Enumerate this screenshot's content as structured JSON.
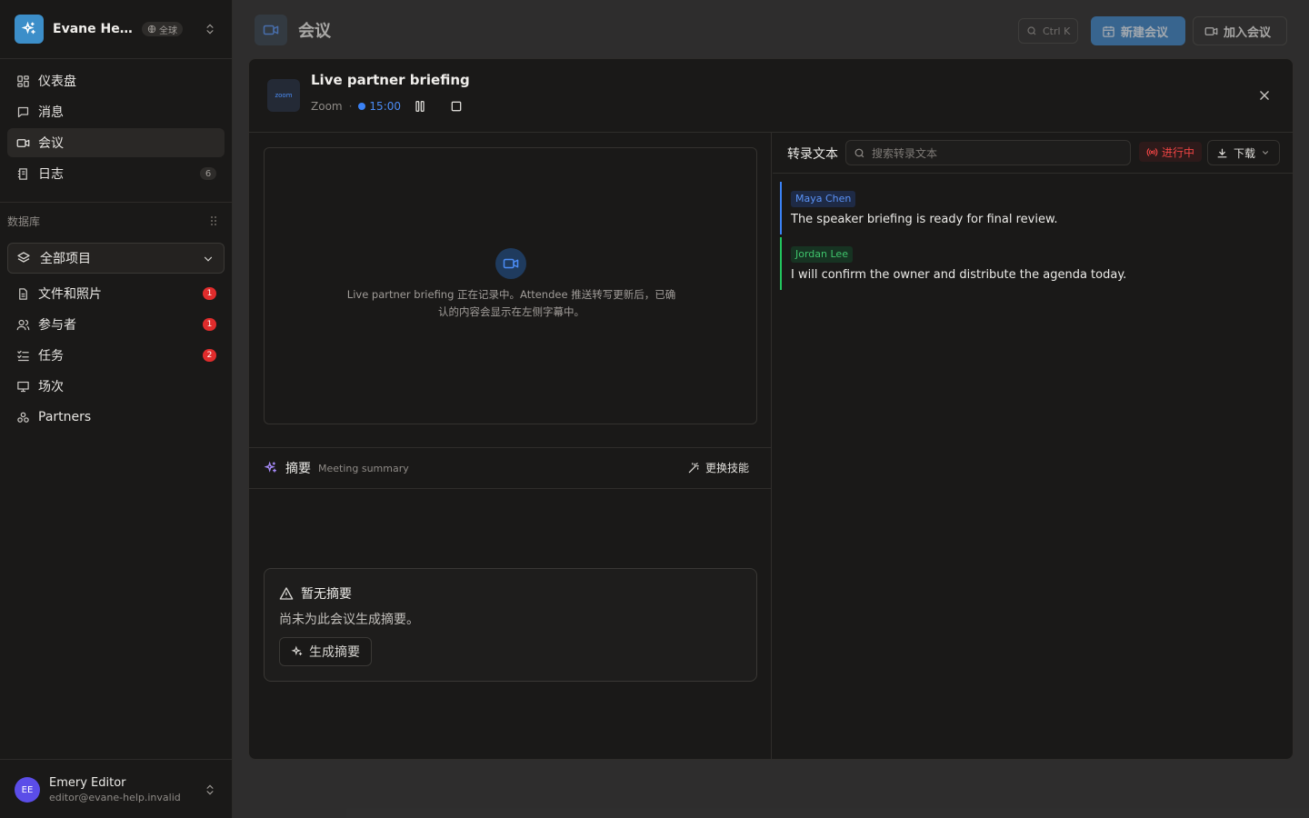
{
  "workspace": {
    "name": "Evane Help Center",
    "badge": "全球"
  },
  "nav": [
    {
      "id": "dashboard",
      "label": "仪表盘",
      "icon": "dashboard-icon"
    },
    {
      "id": "messages",
      "label": "消息",
      "icon": "message-icon"
    },
    {
      "id": "meetings",
      "label": "会议",
      "icon": "video-icon",
      "active": true
    },
    {
      "id": "logs",
      "label": "日志",
      "icon": "log-icon",
      "count": "6"
    }
  ],
  "database": {
    "label": "数据库",
    "project_select": "全部项目",
    "items": [
      {
        "id": "files",
        "label": "文件和照片",
        "icon": "file-icon",
        "badge": "1"
      },
      {
        "id": "participants",
        "label": "参与者",
        "icon": "users-icon",
        "badge": "1"
      },
      {
        "id": "tasks",
        "label": "任务",
        "icon": "tasks-icon",
        "badge": "2"
      },
      {
        "id": "sessions",
        "label": "场次",
        "icon": "presentation-icon"
      },
      {
        "id": "partners",
        "label": "Partners",
        "icon": "partners-icon"
      }
    ]
  },
  "user": {
    "initials": "EE",
    "name": "Emery Editor",
    "email": "editor@evane-help.invalid"
  },
  "header": {
    "title": "会议",
    "search_shortcut": "Ctrl K",
    "new_meeting": "新建会议",
    "join_meeting": "加入会议"
  },
  "modal": {
    "title": "Live partner briefing",
    "platform_logo": "zoom",
    "platform": "Zoom",
    "timer": "15:00",
    "video_message": "Live partner briefing 正在记录中。Attendee 推送转写更新后，已确认的内容会显示在左侧字幕中。",
    "summary": {
      "title": "摘要",
      "subtitle": "Meeting summary",
      "change_skill": "更换技能",
      "empty_title": "暂无摘要",
      "empty_desc": "尚未为此会议生成摘要。",
      "generate": "生成摘要"
    },
    "transcript": {
      "title": "转录文本",
      "search_placeholder": "搜索转录文本",
      "status": "进行中",
      "download": "下载",
      "utterances": [
        {
          "speaker": "Maya Chen",
          "text": "The speaker briefing is ready for final review.",
          "color": "#3b82f6"
        },
        {
          "speaker": "Jordan Lee",
          "text": "I will confirm the owner and distribute the agenda today.",
          "color": "#22c55e"
        }
      ]
    }
  },
  "colors": {
    "accent": "#3b82f6",
    "live": "#ef4444",
    "badge_red": "#e02c2c",
    "avatar": "#5b4de8"
  }
}
